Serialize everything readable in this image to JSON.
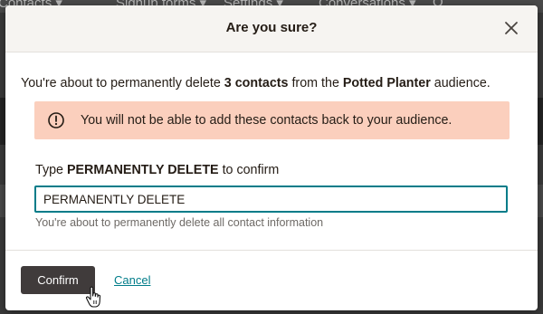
{
  "background": {
    "nav_items": [
      "Contacts ▾",
      "Signup forms ▾",
      "Settings ▾",
      "Conversations ▾",
      "Q"
    ]
  },
  "dialog": {
    "title": "Are you sure?",
    "close_icon": "close-icon",
    "intro": {
      "prefix": "You're about to permanently delete ",
      "count": "3 contacts",
      "middle": " from the ",
      "audience": "Potted Planter",
      "suffix": " audience."
    },
    "warning": {
      "icon": "exclamation-circle-icon",
      "text": "You will not be able to add these contacts back to your audience."
    },
    "confirm_field": {
      "label_prefix": "Type ",
      "label_keyword": "PERMANENTLY DELETE",
      "label_suffix": " to confirm",
      "value": "PERMANENTLY DELETE",
      "helper": "You're about to permanently delete all contact information"
    },
    "confirm_button": "Confirm",
    "cancel_link": "Cancel"
  },
  "colors": {
    "warning_bg": "#fbcfbd",
    "input_border": "#007c89",
    "button_bg": "#403b3b",
    "link": "#007c89"
  }
}
